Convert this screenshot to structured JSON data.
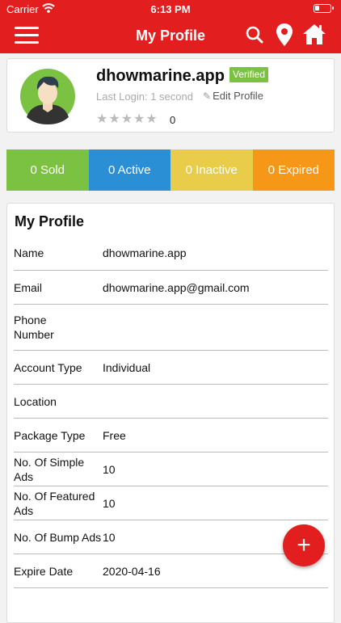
{
  "status_bar": {
    "carrier": "Carrier",
    "time": "6:13 PM"
  },
  "nav": {
    "title": "My Profile",
    "icons": [
      "menu-icon",
      "search-icon",
      "location-pin-icon",
      "home-icon"
    ]
  },
  "profile": {
    "username": "dhowmarine.app",
    "verified_label": "Verified",
    "last_login": "Last Login: 1 second",
    "edit_label": "Edit Profile",
    "stars": "★★★★★",
    "rating_count": "0"
  },
  "stats": {
    "sold": "0 Sold",
    "active": "0 Active",
    "inactive": "0 Inactive",
    "expired": "0 Expired",
    "colors": {
      "sold": "#7cc242",
      "active": "#2b8fd6",
      "inactive": "#e9cc4a",
      "expired": "#f79718"
    }
  },
  "details": {
    "heading": "My Profile",
    "rows": [
      {
        "label": "Name",
        "value": "dhowmarine.app"
      },
      {
        "label": "Email",
        "value": "dhowmarine.app@gmail.com"
      },
      {
        "label": "Phone Number",
        "value": ""
      },
      {
        "label": "Account Type",
        "value": "Individual"
      },
      {
        "label": "Location",
        "value": ""
      },
      {
        "label": "Package Type",
        "value": "Free"
      },
      {
        "label": "No. Of Simple Ads",
        "value": "10"
      },
      {
        "label": "No. Of Featured Ads",
        "value": "10"
      },
      {
        "label": "No. Of Bump Ads",
        "value": "10"
      },
      {
        "label": "Expire Date",
        "value": "2020-04-16"
      }
    ]
  },
  "fab": {
    "label": "+"
  },
  "theme": {
    "accent": "#e31e1e"
  }
}
